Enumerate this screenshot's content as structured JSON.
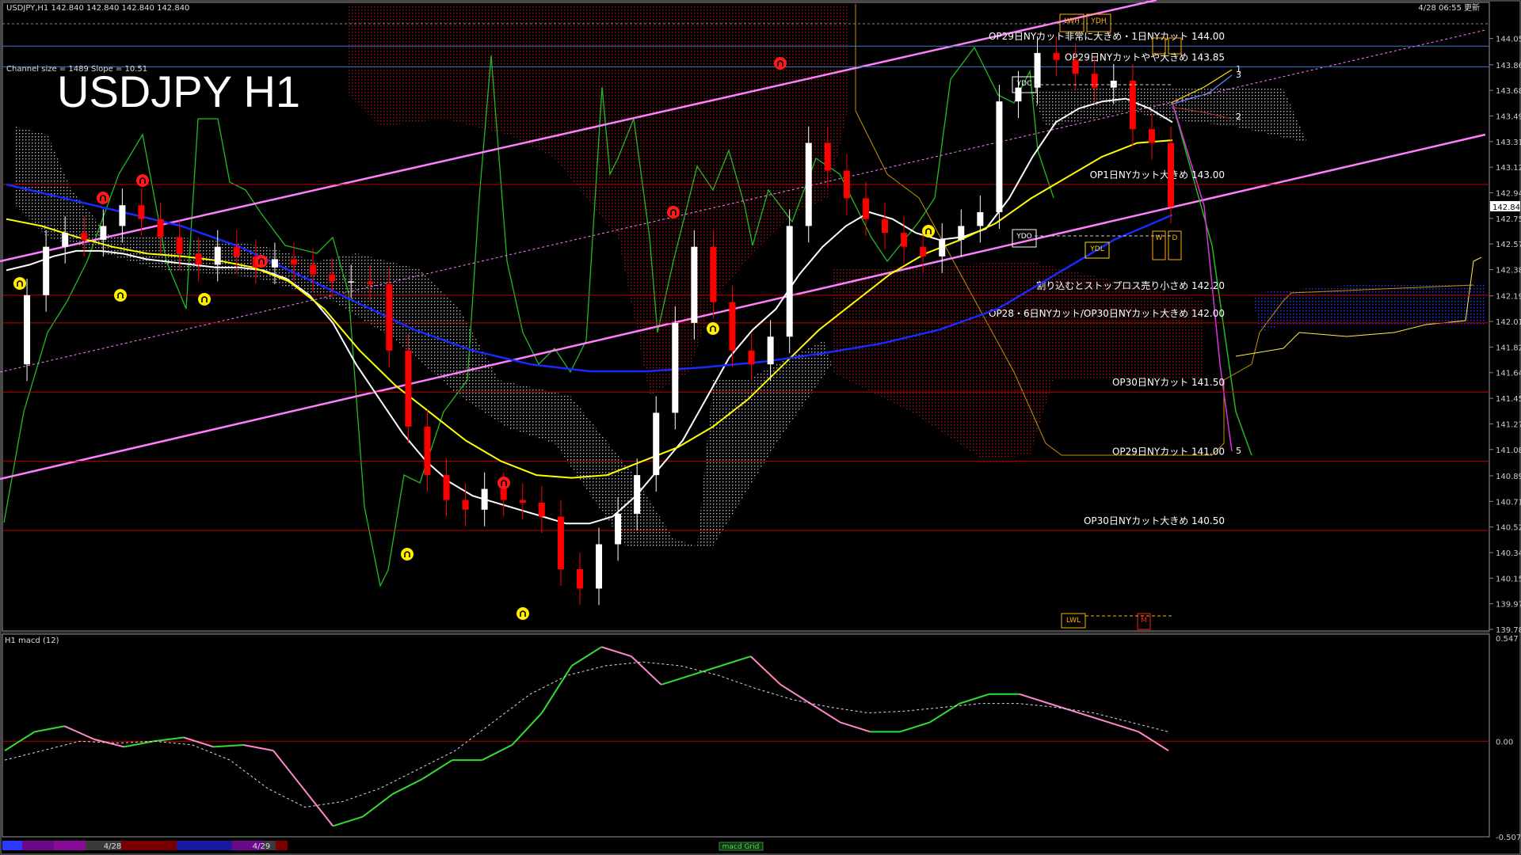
{
  "header": {
    "symbol_line": "USDJPY,H1  142.840 142.840 142.840 142.840",
    "timestamp": "4/28 06:55 更新"
  },
  "title": "USDJPY H1",
  "channel_info": "Channel size = 1489 Slope = 10.51",
  "colors": {
    "background": "#000000",
    "candle_up": "#ffffff",
    "candle_down": "#ff0000",
    "ma_white": "#ffffff",
    "ma_yellow": "#ffff00",
    "ma_blue": "#1a2aff",
    "channel": "#ff7fff",
    "kumo_red": "#a01818",
    "kumo_white": "#bbbbbb",
    "kumo_blue": "#2a3aff",
    "level_line": "#c00000",
    "macd": "#33dd33",
    "macd_down": "#ff88cc",
    "green_line": "#22bb22",
    "orange": "#ffb000"
  },
  "chart_data": [
    {
      "type": "line",
      "title": "USDJPY H1",
      "ylim": [
        139.785,
        144.19
      ],
      "y_ticks": [
        "144.055",
        "143.865",
        "143.680",
        "143.495",
        "143.310",
        "143.125",
        "142.940",
        "142.755",
        "142.570",
        "142.385",
        "142.195",
        "142.010",
        "141.825",
        "141.640",
        "141.455",
        "141.270",
        "141.085",
        "140.895",
        "140.710",
        "140.525",
        "140.340",
        "140.155",
        "139.970",
        "139.785"
      ],
      "current_price": "142.840",
      "levels": [
        {
          "label": "OP29日NYカット非常に大きめ・1日NYカット 144.00",
          "value": 144.0
        },
        {
          "label": "OP29日NYカットやや大きめ 143.85",
          "value": 143.85
        },
        {
          "label": "OP1日NYカット大きめ 143.00",
          "value": 143.0
        },
        {
          "label": "割り込むとストップロス売り小さめ 142.20",
          "value": 142.2
        },
        {
          "label": "OP28・6日NYカット/OP30日NYカット大きめ 142.00",
          "value": 142.0
        },
        {
          "label": "OP30日NYカット 141.50",
          "value": 141.5
        },
        {
          "label": "OP29日NYカット 141.00",
          "value": 141.0
        },
        {
          "label": "OP30日NYカット大きめ 140.50",
          "value": 140.5
        }
      ],
      "boxes": [
        "YDH",
        "LWH",
        "YDC",
        "YDO",
        "YDL",
        "LWL",
        "W",
        "D",
        "M"
      ],
      "projection_labels": [
        "1",
        "2",
        "3",
        "5"
      ],
      "series": [
        {
          "name": "",
          "role": "price",
          "values": [
            141.7,
            142.2,
            142.55,
            142.65,
            142.6,
            142.7,
            142.85,
            142.75,
            142.62,
            142.5,
            142.42,
            142.55,
            142.48,
            142.4,
            142.46,
            142.42,
            142.35,
            142.3,
            142.3,
            142.28,
            141.8,
            141.25,
            140.9,
            140.72,
            140.65,
            140.8,
            140.72,
            140.7,
            140.6,
            140.22,
            140.08,
            140.4,
            140.62,
            140.9,
            141.35,
            142.0,
            142.55,
            142.15,
            141.8,
            141.7,
            141.9,
            142.7,
            143.3,
            143.1,
            142.9,
            142.75,
            142.65,
            142.55,
            142.48,
            142.6,
            142.7,
            142.8,
            143.6,
            143.7,
            143.95,
            143.9,
            143.8,
            143.7,
            143.75,
            143.4,
            143.3,
            142.84
          ]
        },
        {
          "name": "",
          "role": "ma_fast",
          "values": [
            142.38,
            142.42,
            142.48,
            142.52,
            142.52,
            142.5,
            142.46,
            142.44,
            142.42,
            142.4,
            142.4,
            142.38,
            142.32,
            142.2,
            142.0,
            141.7,
            141.45,
            141.2,
            141.0,
            140.85,
            140.75,
            140.7,
            140.65,
            140.6,
            140.55,
            140.55,
            140.6,
            140.75,
            140.95,
            141.15,
            141.45,
            141.75,
            141.95,
            142.1,
            142.35,
            142.55,
            142.7,
            142.8,
            142.75,
            142.65,
            142.6,
            142.62,
            142.68,
            142.9,
            143.2,
            143.45,
            143.55,
            143.6,
            143.62,
            143.55,
            143.45
          ]
        },
        {
          "name": "",
          "role": "ma_mid",
          "values": [
            142.75,
            142.7,
            142.62,
            142.55,
            142.5,
            142.48,
            142.45,
            142.4,
            142.3,
            142.1,
            141.8,
            141.55,
            141.35,
            141.15,
            141.0,
            140.9,
            140.88,
            140.9,
            141.0,
            141.1,
            141.25,
            141.45,
            141.7,
            141.95,
            142.15,
            142.35,
            142.5,
            142.6,
            142.72,
            142.9,
            143.05,
            143.2,
            143.3,
            143.32
          ]
        },
        {
          "name": "",
          "role": "ma_slow",
          "values": [
            143.0,
            142.9,
            142.8,
            142.7,
            142.55,
            142.35,
            142.15,
            141.95,
            141.8,
            141.7,
            141.65,
            141.65,
            141.68,
            141.72,
            141.78,
            141.85,
            141.95,
            142.1,
            142.35,
            142.6,
            142.78
          ]
        }
      ]
    },
    {
      "type": "line",
      "title": "H1  macd (12)",
      "ylim": [
        -0.507,
        0.547
      ],
      "y_ticks": [
        "0.547",
        "0.00",
        "-0.507"
      ],
      "series": [
        {
          "name": "",
          "role": "macd",
          "values": [
            -0.05,
            0.05,
            0.08,
            0.01,
            -0.03,
            0.0,
            0.02,
            -0.03,
            -0.02,
            -0.05,
            -0.25,
            -0.45,
            -0.4,
            -0.28,
            -0.2,
            -0.1,
            -0.1,
            -0.02,
            0.15,
            0.4,
            0.5,
            0.45,
            0.3,
            0.35,
            0.4,
            0.45,
            0.3,
            0.2,
            0.1,
            0.05,
            0.05,
            0.1,
            0.2,
            0.25,
            0.25,
            0.2,
            0.15,
            0.1,
            0.05,
            -0.05
          ]
        },
        {
          "name": "",
          "role": "signal",
          "values": [
            -0.1,
            -0.05,
            0.0,
            -0.01,
            0.0,
            -0.02,
            -0.1,
            -0.25,
            -0.35,
            -0.32,
            -0.25,
            -0.15,
            -0.05,
            0.1,
            0.25,
            0.35,
            0.4,
            0.42,
            0.4,
            0.35,
            0.28,
            0.22,
            0.18,
            0.15,
            0.16,
            0.18,
            0.2,
            0.2,
            0.18,
            0.15,
            0.1,
            0.05
          ]
        }
      ]
    }
  ],
  "bottom_dates": [
    "4/28",
    "4/29"
  ],
  "macd_tag": "macd Grid"
}
